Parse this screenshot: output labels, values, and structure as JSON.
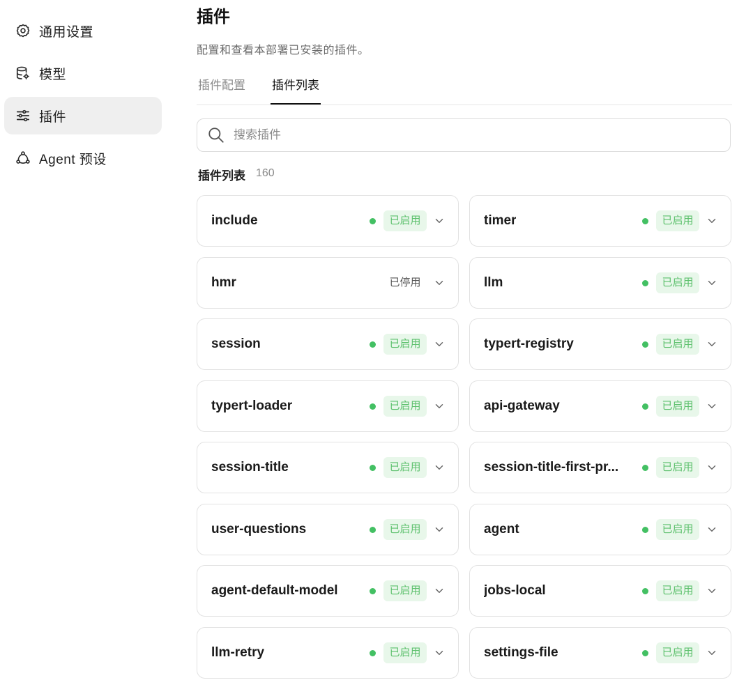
{
  "sidebar": {
    "items": [
      {
        "label": "通用设置",
        "icon": "gear-icon",
        "active": false
      },
      {
        "label": "模型",
        "icon": "database-icon",
        "active": false
      },
      {
        "label": "插件",
        "icon": "sliders-icon",
        "active": true
      },
      {
        "label": "Agent 预设",
        "icon": "agent-network-icon",
        "active": false
      }
    ]
  },
  "header": {
    "title": "插件",
    "description": "配置和查看本部署已安装的插件。"
  },
  "tabs": [
    {
      "label": "插件配置",
      "active": false
    },
    {
      "label": "插件列表",
      "active": true
    }
  ],
  "search": {
    "placeholder": "搜索插件",
    "value": ""
  },
  "list": {
    "heading": "插件列表",
    "count": "160",
    "plugins": [
      {
        "name": "include",
        "status": "已启用",
        "enabled": true
      },
      {
        "name": "timer",
        "status": "已启用",
        "enabled": true
      },
      {
        "name": "hmr",
        "status": "已停用",
        "enabled": false
      },
      {
        "name": "llm",
        "status": "已启用",
        "enabled": true
      },
      {
        "name": "session",
        "status": "已启用",
        "enabled": true
      },
      {
        "name": "typert-registry",
        "status": "已启用",
        "enabled": true
      },
      {
        "name": "typert-loader",
        "status": "已启用",
        "enabled": true
      },
      {
        "name": "api-gateway",
        "status": "已启用",
        "enabled": true
      },
      {
        "name": "session-title",
        "status": "已启用",
        "enabled": true
      },
      {
        "name": "session-title-first-pr...",
        "status": "已启用",
        "enabled": true
      },
      {
        "name": "user-questions",
        "status": "已启用",
        "enabled": true
      },
      {
        "name": "agent",
        "status": "已启用",
        "enabled": true
      },
      {
        "name": "agent-default-model",
        "status": "已启用",
        "enabled": true
      },
      {
        "name": "jobs-local",
        "status": "已启用",
        "enabled": true
      },
      {
        "name": "llm-retry",
        "status": "已启用",
        "enabled": true
      },
      {
        "name": "settings-file",
        "status": "已启用",
        "enabled": true
      }
    ]
  },
  "colors": {
    "enabled_dot": "#43c063",
    "enabled_badge_bg": "#e8f7ea",
    "enabled_badge_text": "#5cc06c",
    "active_nav_bg": "#efefef"
  }
}
